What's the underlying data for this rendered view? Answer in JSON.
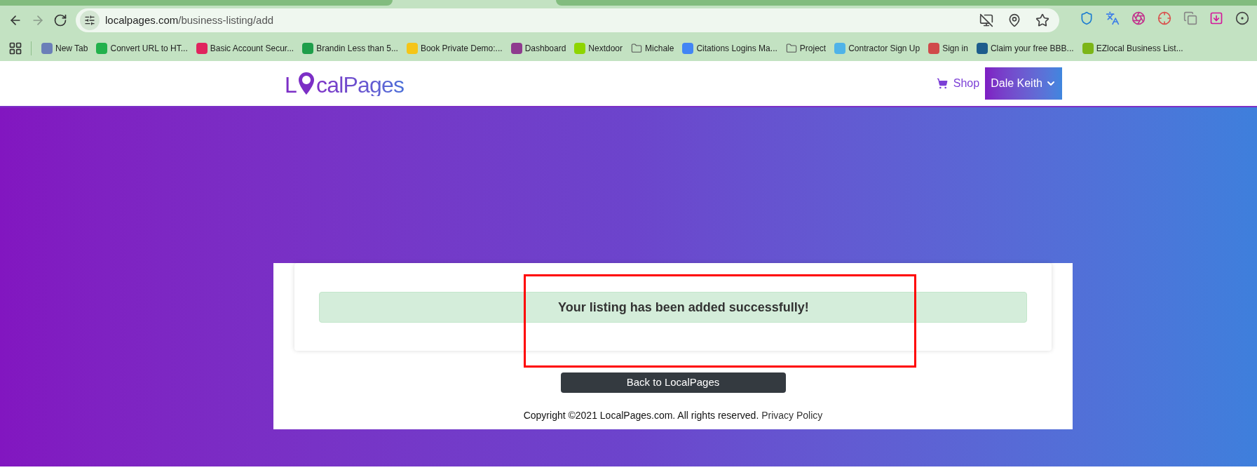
{
  "browser": {
    "url_host": "localpages.com",
    "url_path": "/business-listing/add",
    "bookmarks": [
      {
        "label": "New Tab",
        "kind": "site",
        "color": "#6b7fb8"
      },
      {
        "label": "Convert URL to HT...",
        "kind": "site",
        "color": "#22b14c"
      },
      {
        "label": "Basic Account Secur...",
        "kind": "site",
        "color": "#e0245e"
      },
      {
        "label": "Brandin Less than 5...",
        "kind": "site",
        "color": "#1e9e4a"
      },
      {
        "label": "Book Private Demo:...",
        "kind": "site",
        "color": "#f5c518"
      },
      {
        "label": "Dashboard",
        "kind": "site",
        "color": "#8e3b8e"
      },
      {
        "label": "Nextdoor",
        "kind": "site",
        "color": "#8ed500"
      },
      {
        "label": "Michale",
        "kind": "folder"
      },
      {
        "label": "Citations Logins Ma...",
        "kind": "site",
        "color": "#4285f4"
      },
      {
        "label": "Project",
        "kind": "folder"
      },
      {
        "label": "Contractor Sign Up",
        "kind": "site",
        "color": "#4fb3e8"
      },
      {
        "label": "Sign in",
        "kind": "site",
        "color": "#d04a4a"
      },
      {
        "label": "Claim your free BBB...",
        "kind": "site",
        "color": "#1d5d8c"
      },
      {
        "label": "EZlocal Business List...",
        "kind": "site",
        "color": "#7cb518"
      }
    ]
  },
  "site": {
    "logo_start": "L",
    "logo_end": "calPages",
    "shop": "Shop",
    "user": "Dale Keith"
  },
  "alert": "Your listing has been added successfully!",
  "back_button": "Back to LocalPages",
  "footer": {
    "copyright": "Copyright ©2021 LocalPages.com. All rights reserved.",
    "link": "Privacy Policy"
  }
}
